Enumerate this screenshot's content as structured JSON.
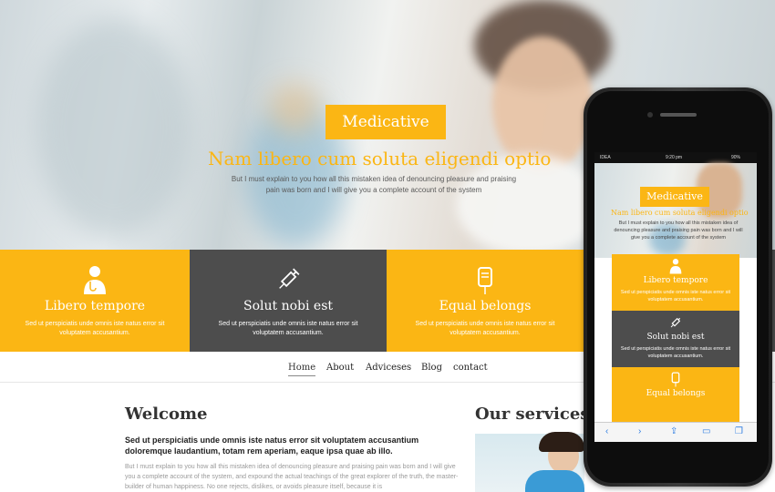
{
  "hero": {
    "brand": "Medicative",
    "heading": "Nam libero cum soluta eligendi optio",
    "text": "But I must explain to you how all this mistaken idea of denouncing pleasure and praising pain was born and I will give you a complete account of the system"
  },
  "features": [
    {
      "title": "Libero tempore",
      "text": "Sed ut perspiciatis unde omnis iste natus error sit voluptatem accusantium.",
      "icon": "doctor-icon",
      "color": "#fbb614"
    },
    {
      "title": "Solut nobi est",
      "text": "Sed ut perspiciatis unde omnis iste natus error sit voluptatem accusantium.",
      "icon": "syringe-icon",
      "color": "#4d4d4d"
    },
    {
      "title": "Equal belongs",
      "text": "Sed ut perspiciatis unde omnis iste natus error sit voluptatem accusantium.",
      "icon": "iv-bag-icon",
      "color": "#fbb614"
    }
  ],
  "nav": {
    "items": [
      "Home",
      "About",
      "Adviceses",
      "Blog",
      "contact"
    ],
    "active": "Home"
  },
  "welcome": {
    "title": "Welcome",
    "lead": "Sed ut perspiciatis unde omnis iste natus error sit voluptatem accusantium doloremque laudantium, totam rem aperiam, eaque ipsa quae ab illo.",
    "body": "But I must explain to you how all this mistaken idea of denouncing pleasure and praising pain was born and I will give you a complete account of the system, and expound the actual teachings of the great explorer of the truth, the master-builder of human happiness. No one rejects, dislikes, or avoids pleasure itself, because it is"
  },
  "services": {
    "title": "Our services"
  },
  "phone": {
    "carrier": "IDEA",
    "time": "9:20 pm",
    "battery": "90%",
    "brand": "Medicative",
    "heading": "Nam libero cum soluta eligendi optio",
    "text": "But I must explain to you how all this mistaken idea of denouncing pleasure and praising pain was born and I will give you a complete account of the system",
    "features": [
      {
        "title": "Libero tempore",
        "text": "Sed ut perspiciatis unde omnis iste natus error sit voluptatem accusantium."
      },
      {
        "title": "Solut nobi est",
        "text": "Sed ut perspiciatis unde omnis iste natus error sit voluptatem accusantium."
      },
      {
        "title": "Equal belongs",
        "text": ""
      }
    ],
    "toolbar": [
      "back-icon",
      "forward-icon",
      "share-icon",
      "bookmarks-icon",
      "tabs-icon"
    ]
  },
  "colors": {
    "accent": "#fbb614",
    "dark": "#4d4d4d"
  }
}
